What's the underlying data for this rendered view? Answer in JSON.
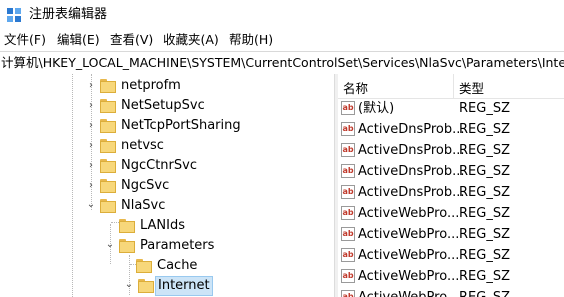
{
  "window": {
    "title": "注册表编辑器"
  },
  "menu": [
    "文件(F)",
    "编辑(E)",
    "查看(V)",
    "收藏夹(A)",
    "帮助(H)"
  ],
  "address": "计算机\\HKEY_LOCAL_MACHINE\\SYSTEM\\CurrentControlSet\\Services\\NlaSvc\\Parameters\\Internet",
  "tree": [
    {
      "label": "netprofm",
      "chevron": "›"
    },
    {
      "label": "NetSetupSvc",
      "chevron": "›"
    },
    {
      "label": "NetTcpPortSharing",
      "chevron": "›"
    },
    {
      "label": "netvsc",
      "chevron": "›"
    },
    {
      "label": "NgcCtnrSvc",
      "chevron": "›"
    },
    {
      "label": "NgcSvc",
      "chevron": "›"
    },
    {
      "label": "NlaSvc",
      "chevron": "⌄"
    },
    {
      "label": "LANIds",
      "chevron": ""
    },
    {
      "label": "Parameters",
      "chevron": "⌄"
    },
    {
      "label": "Cache",
      "chevron": ""
    },
    {
      "label": "Internet",
      "chevron": "⌄"
    }
  ],
  "list": {
    "columns": {
      "name": "名称",
      "type": "类型"
    },
    "rows": [
      {
        "name": "(默认)",
        "type": "REG_SZ"
      },
      {
        "name": "ActiveDnsProb...",
        "type": "REG_SZ"
      },
      {
        "name": "ActiveDnsProb...",
        "type": "REG_SZ"
      },
      {
        "name": "ActiveDnsProb...",
        "type": "REG_SZ"
      },
      {
        "name": "ActiveDnsProb...",
        "type": "REG_SZ"
      },
      {
        "name": "ActiveWebPro...",
        "type": "REG_SZ"
      },
      {
        "name": "ActiveWebPro...",
        "type": "REG_SZ"
      },
      {
        "name": "ActiveWebPro...",
        "type": "REG_SZ"
      },
      {
        "name": "ActiveWebPro...",
        "type": "REG_SZ"
      },
      {
        "name": "ActiveWebPro...",
        "type": "REG_SZ"
      }
    ],
    "icon_text": "ab"
  }
}
